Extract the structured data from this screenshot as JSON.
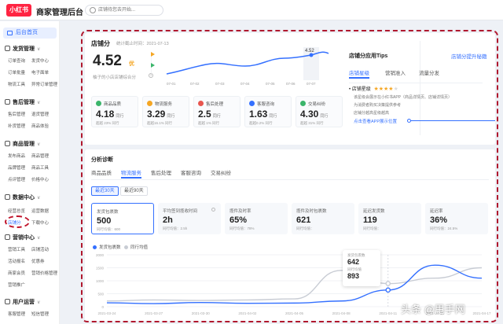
{
  "header": {
    "logo": "小红书",
    "title": "商家管理后台",
    "search_placeholder": "店铺待您去开始..."
  },
  "sidebar": {
    "home": "后台首页",
    "groups": [
      {
        "label": "发货管理",
        "items": [
          "订单查询",
          "发货中心",
          "订单批量",
          "电子面单",
          "物流工具",
          "异常订单管理"
        ]
      },
      {
        "label": "售后管理",
        "items": [
          "售后管理",
          "退货管理",
          "补货管理",
          "商品体验"
        ]
      },
      {
        "label": "商品管理",
        "items": [
          "发布商品",
          "商品管理",
          "品牌管理",
          "商品工具",
          "点评管理",
          "价格中心"
        ]
      },
      {
        "label": "数据中心",
        "items": [
          "经营总览",
          "运营数据",
          "店铺分",
          "下载中心"
        ]
      },
      {
        "label": "营销中心",
        "items": [
          "营销工具",
          "店铺活动",
          "活动报名",
          "优惠券",
          "商家会员",
          "营销价格管理",
          "营销推广"
        ]
      },
      {
        "label": "用户运营",
        "items": [
          "客服管理",
          "短信管理"
        ]
      }
    ]
  },
  "overview": {
    "title": "店铺分",
    "stat_date": "统计截止时间：2021-07-13",
    "score": "4.52",
    "score_level": "优",
    "score_desc": "柚子的小店店铺综合分",
    "trend_peak_label": "4.52",
    "trend_dates": [
      "07-01",
      "07-02",
      "07-03",
      "07-04",
      "07-05",
      "07-06",
      "07-07"
    ],
    "metrics": [
      {
        "label": "商品品质",
        "value": "4.18",
        "unit": "同行",
        "sub": "超越 23% 同行",
        "color": "#3bb56b"
      },
      {
        "label": "物流服务",
        "value": "3.29",
        "unit": "同行",
        "sub": "超越16.1% 同行",
        "color": "#f5a623"
      },
      {
        "label": "售后处理",
        "value": "2.5",
        "unit": "同行",
        "sub": "超越 1% 同行",
        "color": "#e8554e"
      },
      {
        "label": "客服咨询",
        "value": "1.63",
        "unit": "同行",
        "sub": "超越0.2% 同行",
        "color": "#3470ff"
      },
      {
        "label": "交易纠纷",
        "value": "4.30",
        "unit": "同行",
        "sub": "超越 31% 同行",
        "color": "#3bb56b"
      }
    ]
  },
  "tips": {
    "title": "店铺分应用Tips",
    "link": "店铺分提升秘籍",
    "tabs": [
      "店铺星级",
      "营销准入",
      "流量分发"
    ],
    "star_label": "店铺星级",
    "stars": 4,
    "desc_lines": [
      "该星级会展示在小红书APP（商品详情页、店铺详情页）",
      "为消费者购买决策提供参考",
      "店铺分越高星级越高"
    ],
    "cta": "点击查看APP展示位置"
  },
  "analysis": {
    "title": "分析诊断",
    "tabs": [
      "商品品质",
      "物流服务",
      "售后处理",
      "客服咨询",
      "交易纠纷"
    ],
    "active_tab": 1,
    "ranges": [
      "最近30天",
      "最近90天"
    ],
    "kpis": [
      {
        "label": "发货包裹数",
        "value": "500",
        "sub": "同行均值：600"
      },
      {
        "label": "平均签到揽收时间",
        "value": "2h",
        "sub": "同行均值：2.5h"
      },
      {
        "label": "揽件及时率",
        "value": "65%",
        "sub": "同行均值：78%"
      },
      {
        "label": "揽件及时包裹数",
        "value": "621",
        "sub": "同行均值："
      },
      {
        "label": "延迟发货数",
        "value": "119",
        "sub": "同行均值："
      },
      {
        "label": "延迟率",
        "value": "36%",
        "sub": "同行均值：24.5%"
      }
    ]
  },
  "chart_data": {
    "type": "line",
    "x": [
      "2021-03-24",
      "2021-03-27",
      "2021-03-30",
      "2021-04-02",
      "2021-04-05",
      "2021-04-08",
      "2021-04-11",
      "2021-04-14",
      "2021-04-17"
    ],
    "yticks": [
      "2000",
      "1500",
      "1000",
      "500",
      "0"
    ],
    "ylim": [
      0,
      2000
    ],
    "series": [
      {
        "name": "发货包裹数",
        "color": "#3470ff",
        "values": [
          150,
          120,
          160,
          130,
          140,
          220,
          642,
          1600,
          1100
        ]
      },
      {
        "name": "同行均值",
        "color": "#c8ccd4",
        "values": [
          220,
          260,
          240,
          260,
          300,
          1400,
          893,
          1100,
          1500
        ]
      }
    ],
    "tooltip": {
      "label1": "发货包裹数",
      "value1": "642",
      "label2": "同行均值",
      "value2": "893"
    }
  },
  "watermark": "头条 @甩手网"
}
